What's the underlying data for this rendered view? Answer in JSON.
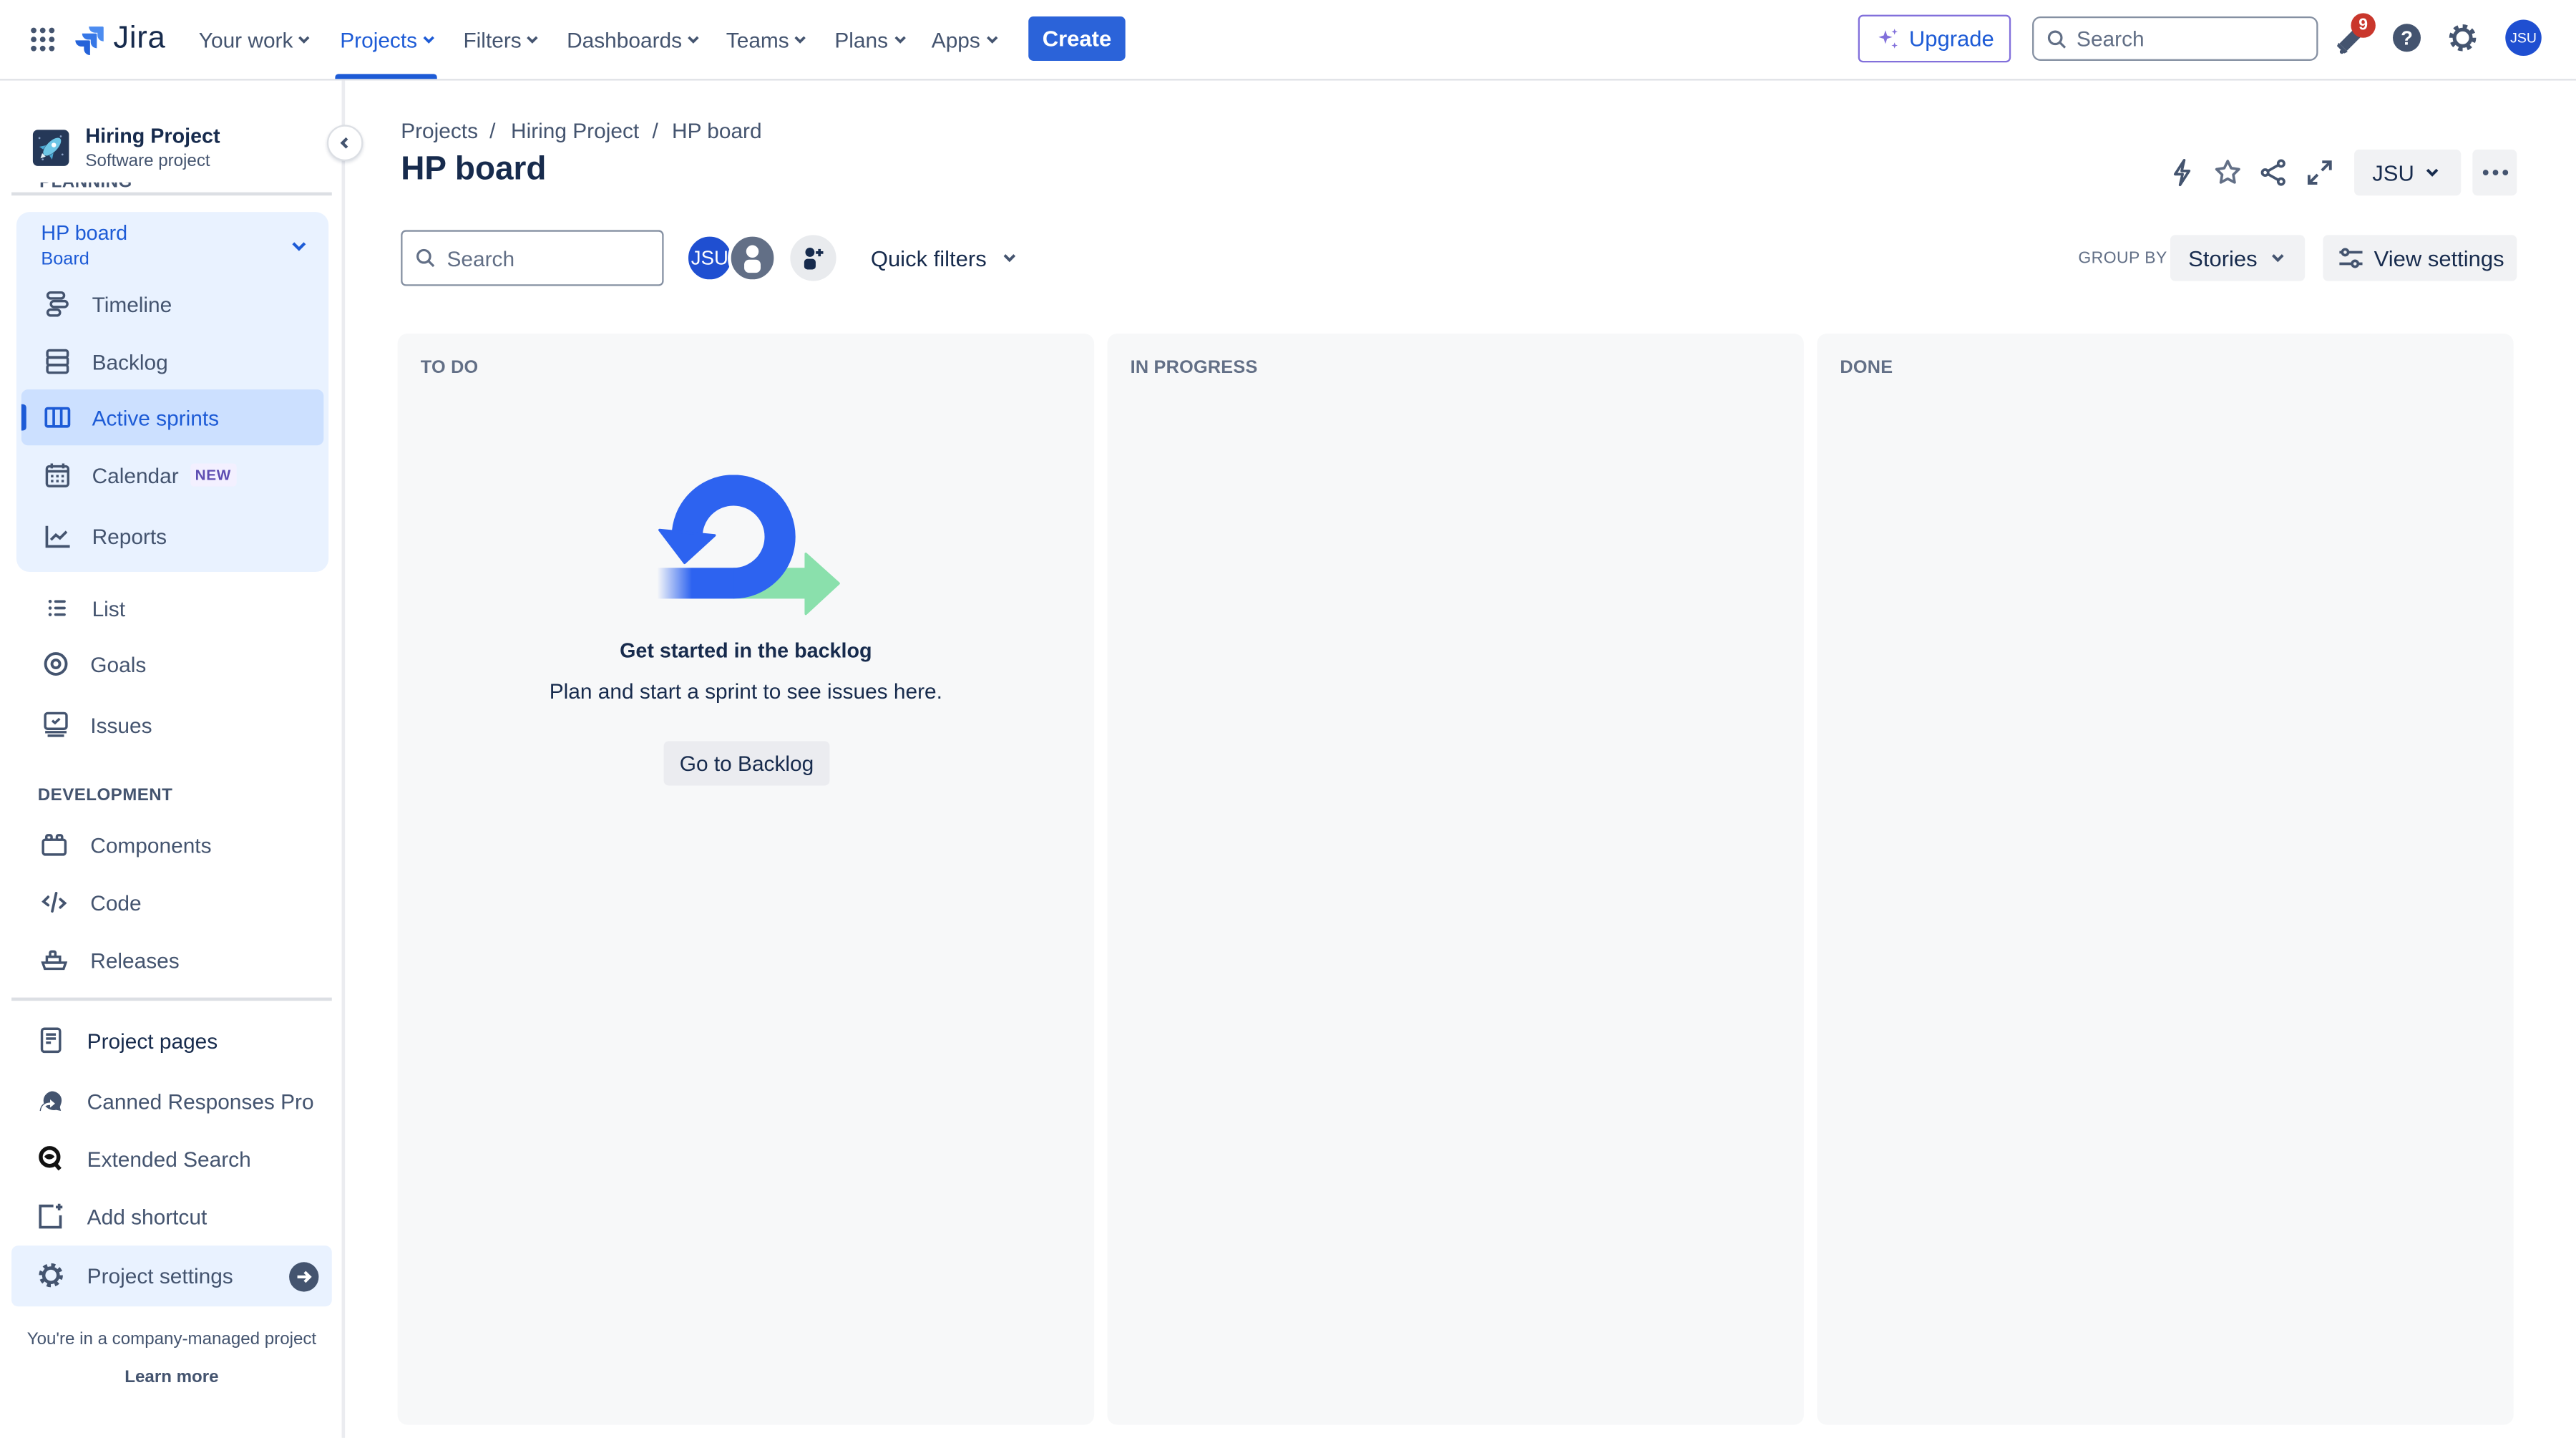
{
  "topnav": {
    "product": "Jira",
    "items": [
      {
        "label": "Your work",
        "active": false
      },
      {
        "label": "Projects",
        "active": true
      },
      {
        "label": "Filters",
        "active": false
      },
      {
        "label": "Dashboards",
        "active": false
      },
      {
        "label": "Teams",
        "active": false
      },
      {
        "label": "Plans",
        "active": false
      },
      {
        "label": "Apps",
        "active": false
      }
    ],
    "create_label": "Create",
    "upgrade_label": "Upgrade",
    "search_placeholder": "Search",
    "notification_count": "9",
    "avatar_initials": "JSU",
    "icons": [
      "app-switcher-icon",
      "jira-logo-icon",
      "sparkle-icon",
      "search-icon",
      "notification-icon",
      "help-icon",
      "settings-icon"
    ]
  },
  "sidebar": {
    "project_name": "Hiring Project",
    "project_type": "Software project",
    "planning_heading": "PLANNING",
    "board": {
      "name": "HP board",
      "type": "Board"
    },
    "board_items": [
      {
        "label": "Timeline",
        "icon": "timeline-icon"
      },
      {
        "label": "Backlog",
        "icon": "backlog-icon"
      },
      {
        "label": "Active sprints",
        "icon": "board-icon",
        "selected": true
      },
      {
        "label": "Calendar",
        "icon": "calendar-icon",
        "badge": "NEW"
      },
      {
        "label": "Reports",
        "icon": "reports-icon"
      }
    ],
    "items": [
      {
        "label": "List",
        "icon": "list-icon"
      },
      {
        "label": "Goals",
        "icon": "goals-icon"
      },
      {
        "label": "Issues",
        "icon": "issues-icon"
      }
    ],
    "development_heading": "DEVELOPMENT",
    "dev_items": [
      {
        "label": "Components",
        "icon": "components-icon"
      },
      {
        "label": "Code",
        "icon": "code-icon"
      },
      {
        "label": "Releases",
        "icon": "releases-icon"
      }
    ],
    "shortcuts": [
      {
        "label": "Project pages",
        "icon": "project-pages-icon"
      },
      {
        "label": "Canned Responses Pro",
        "icon": "canned-responses-icon"
      },
      {
        "label": "Extended Search",
        "icon": "extended-search-icon"
      },
      {
        "label": "Add shortcut",
        "icon": "add-shortcut-icon"
      }
    ],
    "settings_label": "Project settings",
    "footer_text": "You're in a company-managed project",
    "learn_more": "Learn more"
  },
  "main": {
    "breadcrumbs": [
      "Projects",
      "Hiring Project",
      "HP board"
    ],
    "breadcrumb_separator": "/",
    "title": "HP board",
    "owner_button": "JSU",
    "search_placeholder": "Search",
    "avatars": [
      "JSU"
    ],
    "quick_filters": "Quick filters",
    "group_by_label": "GROUP BY",
    "group_by_value": "Stories",
    "view_settings": "View settings",
    "columns": [
      {
        "title": "TO DO"
      },
      {
        "title": "IN PROGRESS"
      },
      {
        "title": "DONE"
      }
    ],
    "empty_state": {
      "title": "Get started in the backlog",
      "text": "Plan and start a sprint to see issues here.",
      "button": "Go to Backlog"
    }
  },
  "colors": {
    "brand_blue": "#1d5bd6",
    "create_button": "#2b63d9",
    "notification_badge": "#c9372c",
    "upgrade_border": "#8270db",
    "avatar_blue": "#1f4fd1",
    "selected_item_bg": "#cce0ff",
    "board_group_bg": "#e9f2ff",
    "column_bg": "#f7f8f9",
    "illustration_green": "#8ae0ac"
  }
}
